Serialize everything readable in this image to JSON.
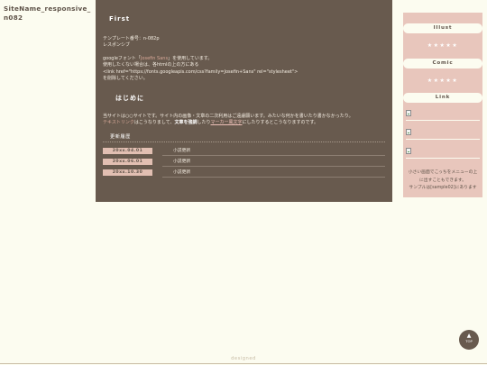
{
  "site": {
    "name": "SiteName_responsive_ n082"
  },
  "main": {
    "first_heading": "First",
    "template_lines": [
      "テンプレート番号：n-082p",
      "レスポンシブ"
    ],
    "font_line_pre": "googleフォント「",
    "font_name": "Josefin Sans",
    "font_line_post": "」を使用しています。",
    "font_note_1": "使用したくない場合は、各htmlの上の方にある",
    "font_code": "<link href=\"https://fonts.googleapis.com/css?family=Josefin+Sans\" rel=\"stylesheet\">",
    "font_note_2": "を削除してください。",
    "intro_heading": "はじめに",
    "intro_line_1": "当サイトは○○サイトです。サイト内の画像・文章の二次利用はご遠慮願います。みたいな何かを書いたり書かなかったり。",
    "intro_text_link": "テキストリンク",
    "intro_line_2_mid": "はこうなりまして、",
    "intro_bold": "文章を強調",
    "intro_line_2_mid2": "したり",
    "intro_marker": "マーカー風文字",
    "intro_line_2_end": "にしたりするとこうなりますのです。",
    "history_title": "更新履歴",
    "history": [
      {
        "date": "20xx.04.01",
        "text": "小説更新"
      },
      {
        "date": "20xx.06.01",
        "text": "小説更新"
      },
      {
        "date": "20xx.10.30",
        "text": "小説更新"
      }
    ]
  },
  "sidebar": {
    "illust_heading": "Illust",
    "illust_stars": "★★★★★",
    "comic_heading": "Comic",
    "comic_stars": "★★★★★",
    "link_heading": "Link",
    "note_1": "小さい画面でこっちをメニューの上",
    "note_2": "に出すこともできます。",
    "note_3": "サンプルは[sample02]にあります"
  },
  "top_button": {
    "label": "TOP"
  },
  "footer": {
    "text": "designed"
  }
}
